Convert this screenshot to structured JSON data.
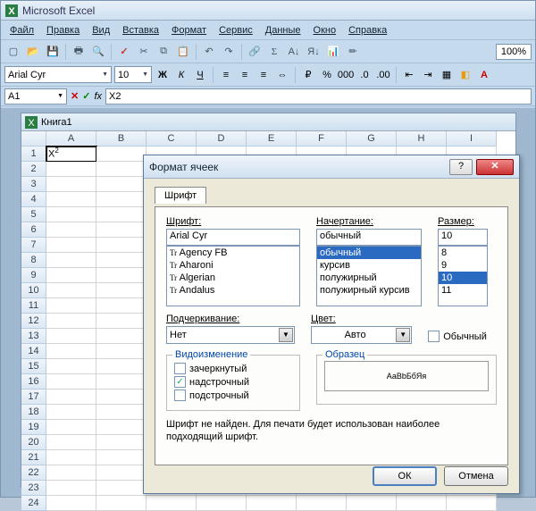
{
  "app": {
    "title": "Microsoft Excel"
  },
  "menu": {
    "file": "Файл",
    "edit": "Правка",
    "view": "Вид",
    "insert": "Вставка",
    "format": "Формат",
    "tools": "Сервис",
    "data": "Данные",
    "window": "Окно",
    "help": "Справка"
  },
  "toolbar": {
    "zoom": "100%"
  },
  "fmt": {
    "font_name": "Arial Cyr",
    "font_size": "10"
  },
  "formula": {
    "name_box": "A1",
    "cancel": "✕",
    "enter": "✓",
    "fx": "fx",
    "value": "X2"
  },
  "workbook": {
    "title": "Книга1",
    "columns": [
      "A",
      "B",
      "C",
      "D",
      "E",
      "F",
      "G",
      "H",
      "I"
    ],
    "active_cell": {
      "row": 1,
      "col": "A",
      "display": "X",
      "sup": "2"
    }
  },
  "dialog": {
    "title": "Формат ячеек",
    "tab": "Шрифт",
    "font_label": "Шрифт:",
    "font_value": "Arial Cyr",
    "font_list": [
      "Agency FB",
      "Aharoni",
      "Algerian",
      "Andalus"
    ],
    "style_label": "Начертание:",
    "style_value": "обычный",
    "style_list": [
      "обычный",
      "курсив",
      "полужирный",
      "полужирный курсив"
    ],
    "style_selected": "обычный",
    "size_label": "Размер:",
    "size_value": "10",
    "size_list": [
      "8",
      "9",
      "10",
      "11"
    ],
    "size_selected": "10",
    "underline_label": "Подчеркивание:",
    "underline_value": "Нет",
    "color_label": "Цвет:",
    "color_value": "Авто",
    "normal_chk": "Обычный",
    "effects_group": "Видоизменение",
    "strike": "зачеркнутый",
    "superscript": "надстрочный",
    "subscript": "подстрочный",
    "sample_label": "Образец",
    "sample_text": "АаВbБбЯя",
    "note": "Шрифт не найден. Для печати будет использован наиболее подходящий шрифт.",
    "ok": "ОК",
    "cancel": "Отмена",
    "help": "?",
    "close": "✕"
  }
}
